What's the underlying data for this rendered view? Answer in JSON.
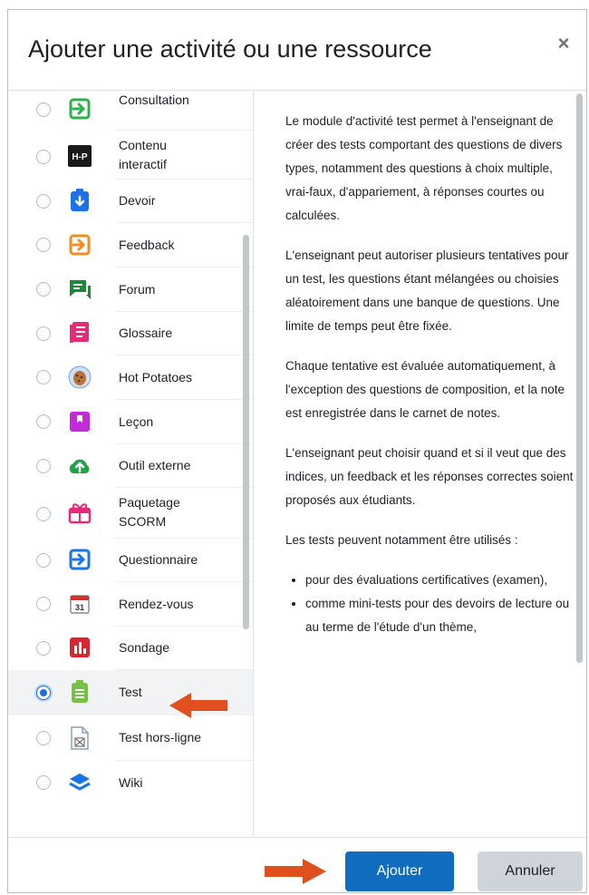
{
  "dialog": {
    "title": "Ajouter une activité ou une ressource",
    "close_icon": "×"
  },
  "activities": [
    {
      "label": "Consultation",
      "icon": "enter-arrow-green-icon",
      "selected": false
    },
    {
      "label": "Contenu\ninteractif",
      "icon": "h5p-icon",
      "selected": false
    },
    {
      "label": "Devoir",
      "icon": "assignment-icon",
      "selected": false
    },
    {
      "label": "Feedback",
      "icon": "enter-arrow-orange-icon",
      "selected": false
    },
    {
      "label": "Forum",
      "icon": "forum-icon",
      "selected": false
    },
    {
      "label": "Glossaire",
      "icon": "glossary-icon",
      "selected": false
    },
    {
      "label": "Hot Potatoes",
      "icon": "hot-potatoes-icon",
      "selected": false
    },
    {
      "label": "Leçon",
      "icon": "lesson-icon",
      "selected": false
    },
    {
      "label": "Outil externe",
      "icon": "external-tool-icon",
      "selected": false
    },
    {
      "label": "Paquetage\nSCORM",
      "icon": "scorm-icon",
      "selected": false
    },
    {
      "label": "Questionnaire",
      "icon": "enter-arrow-blue-icon",
      "selected": false
    },
    {
      "label": "Rendez-vous",
      "icon": "calendar-icon",
      "selected": false
    },
    {
      "label": "Sondage",
      "icon": "survey-icon",
      "selected": false
    },
    {
      "label": "Test",
      "icon": "quiz-icon",
      "selected": true
    },
    {
      "label": "Test hors-ligne",
      "icon": "offline-quiz-icon",
      "selected": false
    },
    {
      "label": "Wiki",
      "icon": "wiki-icon",
      "selected": false
    }
  ],
  "description": {
    "paragraphs": [
      "Le module d'activité test permet à l'enseignant de créer des tests comportant des questions de divers types, notamment des questions à choix multiple, vrai-faux, d'appariement, à réponses courtes ou calculées.",
      "L'enseignant peut autoriser plusieurs tentatives pour un test, les questions étant mélangées ou choisies aléatoirement dans une banque de questions. Une limite de temps peut être fixée.",
      "Chaque tentative est évaluée automatiquement, à l'exception des questions de composition, et la note est enregistrée dans le carnet de notes.",
      "L'enseignant peut choisir quand et si il veut que des indices, un feedback et les réponses correctes soient proposés aux étudiants.",
      "Les tests peuvent notamment être utilisés :"
    ],
    "bullets": [
      "pour des évaluations certificatives (examen),",
      "comme mini-tests pour des devoirs de lecture ou au terme de l'étude d'un thème,"
    ]
  },
  "footer": {
    "add_label": "Ajouter",
    "cancel_label": "Annuler"
  },
  "colors": {
    "primary": "#0f6cbf",
    "annotation_arrow": "#e0501e"
  }
}
